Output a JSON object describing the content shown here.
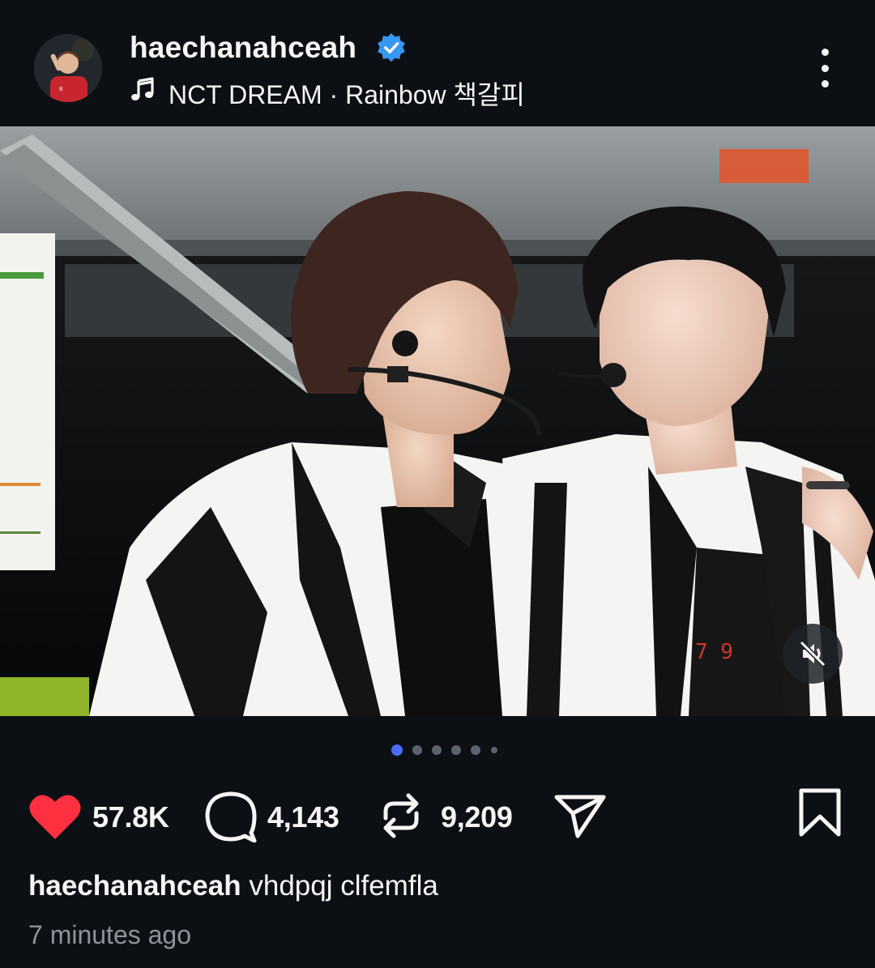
{
  "header": {
    "username": "haechanahceah",
    "song": "NCT DREAM · Rainbow 책갈피",
    "icons": {
      "verified": "verified-badge-icon",
      "music": "music-note-icon",
      "more": "more-options-icon"
    }
  },
  "media": {
    "type": "photo",
    "overlay_digits": "7 9",
    "mute_icon": "muted-speaker-icon"
  },
  "carousel": {
    "total": 6,
    "active_index": 0
  },
  "actions": {
    "likes": "57.8K",
    "comments": "4,143",
    "reposts": "9,209",
    "icons": [
      "heart-icon",
      "comment-icon",
      "repost-icon",
      "share-icon",
      "bookmark-icon"
    ]
  },
  "caption": {
    "username": "haechanahceah",
    "text": "vhdpqj clfemfla"
  },
  "timestamp": "7 minutes ago",
  "colors": {
    "background": "#0c1014",
    "like_red": "#ff3040",
    "verified_blue": "#3897f0",
    "active_dot": "#4a6cf7",
    "muted_text": "#8e939b"
  }
}
